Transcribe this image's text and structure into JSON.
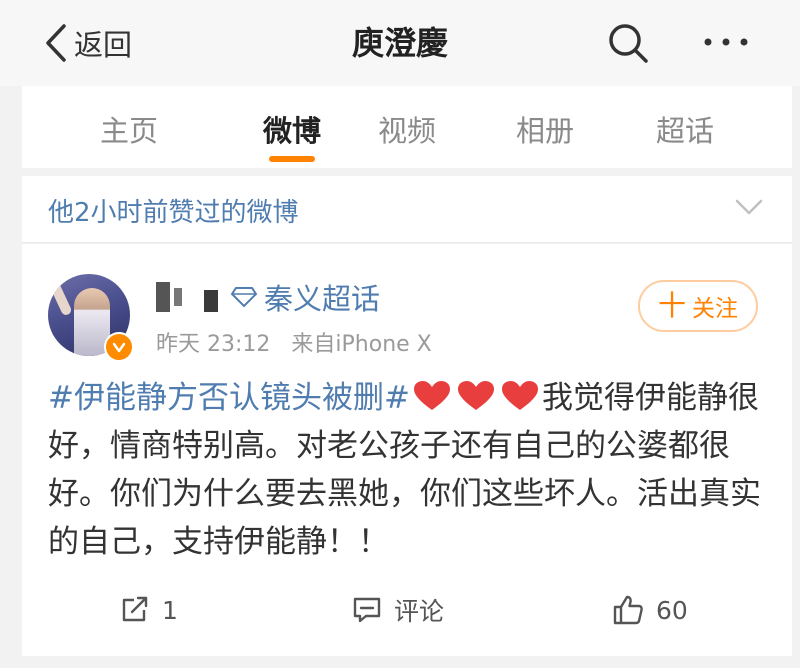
{
  "nav": {
    "back_label": "返回",
    "title": "庾澄慶"
  },
  "tabs": [
    {
      "label": "主页",
      "active": false
    },
    {
      "label": "微博",
      "active": true
    },
    {
      "label": "视频",
      "active": false
    },
    {
      "label": "相册",
      "active": false
    },
    {
      "label": "超话",
      "active": false
    }
  ],
  "liked_bar": {
    "text": "他2小时前赞过的微博"
  },
  "post": {
    "topic": "秦义超话",
    "time": "昨天 23:12",
    "source": "来自iPhone X",
    "follow_label": "关注",
    "follow_plus": "十",
    "hashtag": "#伊能静方否认镜头被删#",
    "text": "我觉得伊能静很好，情商特别高。对老公孩子还有自己的公婆都很好。你们为什么要去黑她，你们这些坏人。活出真实的自己，支持伊能静！！",
    "actions": {
      "repost_count": "1",
      "comment_label": "评论",
      "like_count": "60"
    }
  },
  "colors": {
    "accent": "#ff8200",
    "link": "#507daf",
    "heart": "#e83e3e"
  },
  "icons": [
    "chevron-left-icon",
    "search-icon",
    "more-icon",
    "chevron-down-icon",
    "diamond-icon",
    "verified-badge-icon",
    "heart-icon",
    "repost-icon",
    "comment-icon",
    "like-icon"
  ]
}
